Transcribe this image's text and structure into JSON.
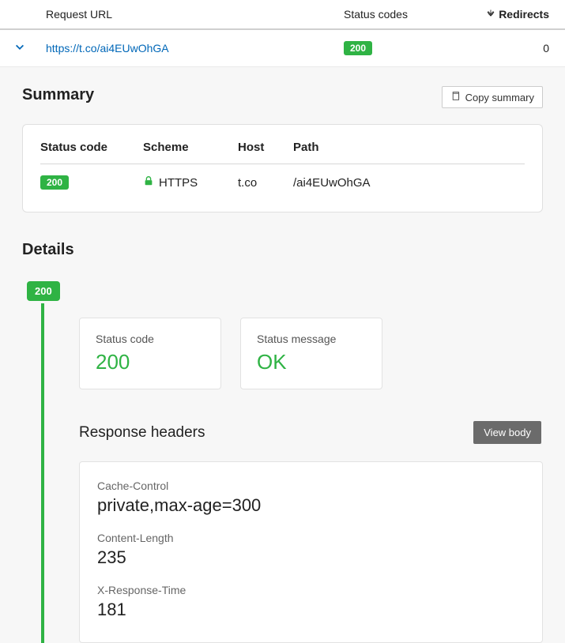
{
  "columns": {
    "url_label": "Request URL",
    "status_label": "Status codes",
    "redirects_label": "Redirects"
  },
  "row": {
    "url": "https://t.co/ai4EUwOhGA",
    "status_badge": "200",
    "redirects": "0"
  },
  "summary": {
    "title": "Summary",
    "copy_label": "Copy summary",
    "headers": {
      "status": "Status code",
      "scheme": "Scheme",
      "host": "Host",
      "path": "Path"
    },
    "values": {
      "status_badge": "200",
      "scheme": "HTTPS",
      "host": "t.co",
      "path": "/ai4EUwOhGA"
    }
  },
  "details": {
    "title": "Details",
    "timeline_badge": "200",
    "status_code": {
      "label": "Status code",
      "value": "200"
    },
    "status_message": {
      "label": "Status message",
      "value": "OK"
    },
    "response_headers_title": "Response headers",
    "view_body_label": "View body",
    "headers": [
      {
        "label": "Cache-Control",
        "value": "private,max-age=300"
      },
      {
        "label": "Content-Length",
        "value": "235"
      },
      {
        "label": "X-Response-Time",
        "value": "181"
      }
    ]
  }
}
